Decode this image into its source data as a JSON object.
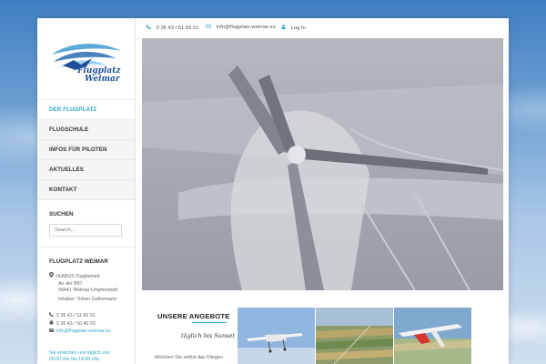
{
  "brand": {
    "logo_line1": "Flugplatz",
    "logo_line2": "Weimar"
  },
  "topbar": {
    "phone": "0 36 43 / 51 82 51",
    "email": "info@flugplatz-weimar.eu",
    "login": "Log In"
  },
  "menu": [
    {
      "label": "DER FLUGPLATZ",
      "active": true
    },
    {
      "label": "FLUGSCHULE",
      "active": false
    },
    {
      "label": "INFOS FÜR PILOTEN",
      "active": false
    },
    {
      "label": "AKTUELLES",
      "active": false
    },
    {
      "label": "KONTAKT",
      "active": false
    }
  ],
  "search": {
    "heading": "SUCHEN",
    "placeholder": "Search..."
  },
  "contact": {
    "heading": "FLUGPLATZ WEIMAR",
    "company": "IKARUS Flugbetrieb",
    "street": "An der B87",
    "city": "99441 Weimar-Umpferstedt",
    "owner": "Inhaber: Sören Gathemann",
    "phone": "0 36 43 / 51 82 51",
    "fax": "0 36 43 / 50 40 53",
    "email": "info@flugplatz-weimar.eu",
    "hours_1": "Sie erreichen uns täglich von",
    "hours_2": "09:00 Uhr bis 18:00 Uhr."
  },
  "offers": {
    "heading": "UNSERE ANGEBOTE",
    "subtitle": "täglich bis Sunset",
    "text": "Möchten Sie selbst das Fliegen"
  },
  "colors": {
    "accent": "#2ca6c6",
    "text": "#333333"
  }
}
